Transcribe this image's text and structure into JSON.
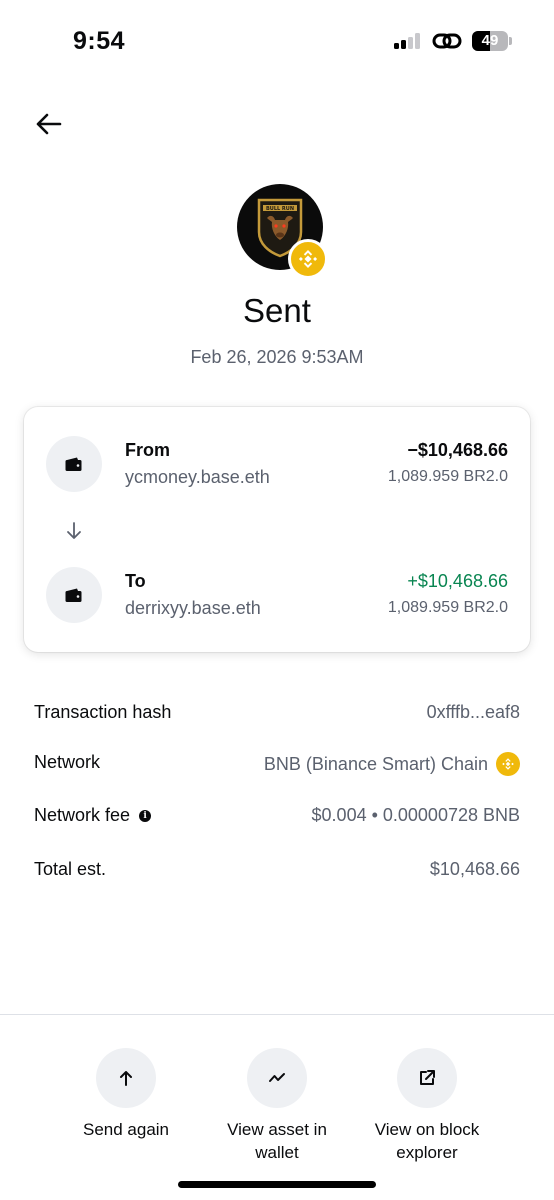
{
  "status_bar": {
    "time": "9:54",
    "battery": "49",
    "battery_level": 0.49
  },
  "header": {
    "title": "Sent",
    "timestamp": "Feb 26, 2026 9:53AM",
    "avatar_text": "BULL RUN"
  },
  "transfer": {
    "from": {
      "label": "From",
      "address": "ycmoney.base.eth",
      "amount": "−$10,468.66",
      "token_amount": "1,089.959 BR2.0"
    },
    "to": {
      "label": "To",
      "address": "derrixyy.base.eth",
      "amount": "+$10,468.66",
      "token_amount": "1,089.959 BR2.0"
    }
  },
  "details": {
    "hash": {
      "label": "Transaction hash",
      "value": "0xfffb...eaf8"
    },
    "network": {
      "label": "Network",
      "value": "BNB (Binance Smart) Chain"
    },
    "fee": {
      "label": "Network fee",
      "value": "$0.004 • 0.00000728 BNB"
    },
    "total": {
      "label": "Total est.",
      "value": "$10,468.66"
    }
  },
  "actions": {
    "send_again": "Send again",
    "view_asset_line1": "View asset in",
    "view_asset_line2": "wallet",
    "view_explorer_line1": "View on block",
    "view_explorer_line2": "explorer"
  },
  "colors": {
    "bnb": "#f0b90b",
    "positive": "#098551",
    "muted": "#5b616e"
  }
}
